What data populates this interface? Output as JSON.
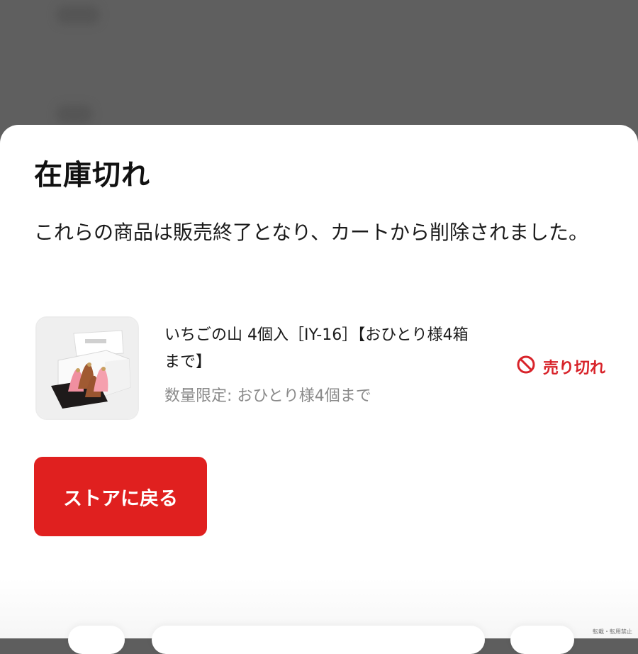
{
  "dialog": {
    "title": "在庫切れ",
    "message": "これらの商品は販売終了となり、カートから削除されました。",
    "back_button_label": "ストアに戻る"
  },
  "items": [
    {
      "name": "いちごの山 4個入［IY-16］【おひとり様4箱まで】",
      "limit": "数量限定: おひとり様4個まで",
      "status": "売り切れ",
      "status_icon": "prohibited-icon",
      "status_color": "#d8232a"
    }
  ],
  "colors": {
    "accent": "#e0201f",
    "overlay": "#5f5f5f"
  },
  "watermark": "転載・転用禁止"
}
